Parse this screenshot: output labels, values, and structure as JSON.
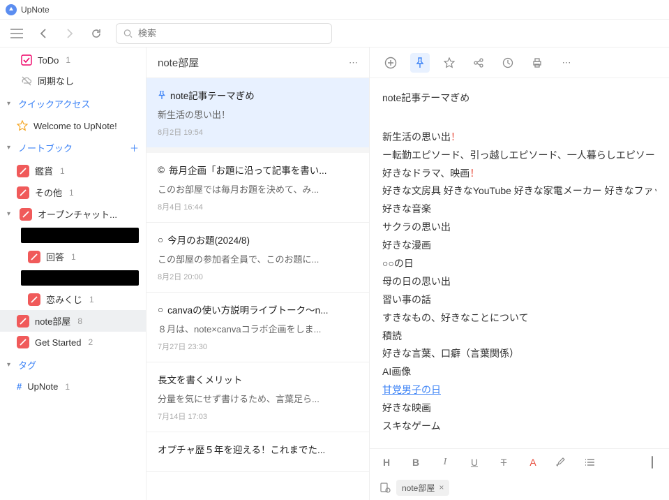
{
  "app": {
    "title": "UpNote"
  },
  "search": {
    "placeholder": "検索"
  },
  "sidebar": {
    "top": [
      {
        "label": "ToDo",
        "count": "1"
      },
      {
        "label": "同期なし"
      }
    ],
    "quick": {
      "header": "クイックアクセス",
      "items": [
        {
          "label": "Welcome to UpNote!"
        }
      ]
    },
    "notebooks": {
      "header": "ノートブック",
      "items": [
        {
          "label": "鑑賞",
          "count": "1"
        },
        {
          "label": "その他",
          "count": "1"
        },
        {
          "label": "オープンチャット...",
          "expanded": true,
          "children": [
            {
              "redacted": true
            },
            {
              "label": "回答",
              "count": "1"
            },
            {
              "redacted": true
            },
            {
              "label": "恋みくじ",
              "count": "1"
            },
            {
              "label": "note部屋",
              "count": "8",
              "selected": true
            },
            {
              "label": "Get Started",
              "count": "2"
            }
          ]
        }
      ]
    },
    "tags": {
      "header": "タグ",
      "items": [
        {
          "label": "UpNote",
          "count": "1"
        }
      ]
    }
  },
  "notelist": {
    "title": "note部屋",
    "items": [
      {
        "pinned": true,
        "title": "note記事テーマぎめ",
        "preview": "新生活の思い出！",
        "date": "8月2日 19:54"
      },
      {
        "icon": "©",
        "title": "毎月企画「お題に沿って記事を書い...",
        "preview": "このお部屋では毎月お題を決めて、み...",
        "date": "8月4日 16:44"
      },
      {
        "icon": "○",
        "title": "今月のお題(2024/8)",
        "preview": "この部屋の参加者全員で、このお題に...",
        "date": "8月2日 20:00"
      },
      {
        "icon": "○",
        "title": "canvaの使い方説明ライブトーク〜n...",
        "preview": "８月は、note×canvaコラボ企画をしま...",
        "date": "7月27日 23:30"
      },
      {
        "title": "長文を書くメリット",
        "preview": "分量を気にせず書けるため、言葉足ら...",
        "date": "7月14日 17:03"
      },
      {
        "title": "オプチャ歴５年を迎える！これまでた..."
      }
    ]
  },
  "editor": {
    "title": "note記事テーマぎめ",
    "lines": [
      {
        "t": ""
      },
      {
        "t": "新生活の思い出",
        "excl": true
      },
      {
        "t": "ー転勤エピソード、引っ越しエピソード、一人暮らしエピソード、ピソード、料理エピソード、入学エピソード"
      },
      {
        "t": "好きなドラマ、映画",
        "excl": true
      },
      {
        "t": "好きな文房具 好きなYouTube 好きな家電メーカー 好きなファッション"
      },
      {
        "t": "好きな音楽"
      },
      {
        "t": "サクラの思い出"
      },
      {
        "t": "好きな漫画"
      },
      {
        "t": "○○の日"
      },
      {
        "t": "母の日の思い出"
      },
      {
        "t": "習い事の話"
      },
      {
        "t": "すきなもの、好きなことについて"
      },
      {
        "t": "積読"
      },
      {
        "t": "好きな言葉、口癖（言葉関係）"
      },
      {
        "t": "AI画像"
      },
      {
        "t": "甘党男子の日",
        "link": true
      },
      {
        "t": "好きな映画"
      },
      {
        "t": "スキなゲーム"
      }
    ],
    "format_labels": {
      "h": "H",
      "b": "B",
      "i": "I",
      "u": "U",
      "s": "T",
      "a": "A"
    },
    "tag": "note部屋"
  }
}
